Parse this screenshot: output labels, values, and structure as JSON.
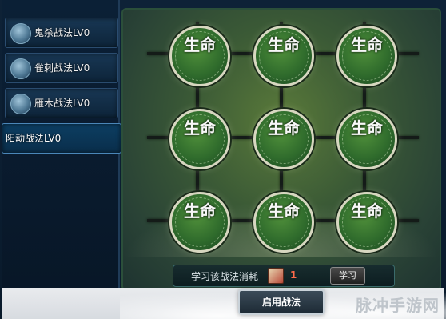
{
  "sidebar": {
    "items": [
      {
        "label": "鬼杀战法LV0"
      },
      {
        "label": "雀刺战法LV0"
      },
      {
        "label": "雁木战法LV0"
      },
      {
        "label": "阳动战法LV0",
        "active": true
      }
    ]
  },
  "board": {
    "node_label": "生命",
    "node_count": 9
  },
  "cost": {
    "label": "学习该战法消耗",
    "value": "1",
    "learn_button": "学习"
  },
  "footer": {
    "enable_button": "启用战法",
    "watermark": "脉冲手游网"
  },
  "colors": {
    "sidebar_bg": "#0b2036",
    "board_green": "#3b5a36",
    "node_green": "#2f6b2c",
    "cost_value": "#ff6a4a"
  }
}
